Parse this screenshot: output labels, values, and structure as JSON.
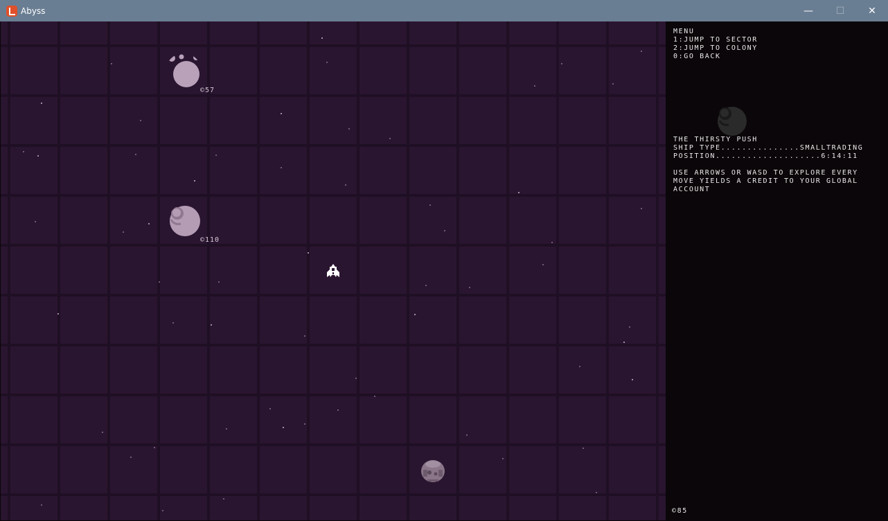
{
  "window": {
    "title": "Abyss",
    "controls": {
      "minimize": "—",
      "maximize": "☐",
      "close": "✕"
    }
  },
  "map": {
    "planets": [
      {
        "name": "planet-with-moons",
        "credit_label": "©57",
        "color": "#b8a1b9"
      },
      {
        "name": "cratered-planet",
        "credit_label": "©110",
        "color": "#b49cb5"
      }
    ],
    "player_ship": {
      "icon": "spaceship-icon",
      "color": "#ffffff"
    },
    "colony": {
      "icon": "colony-pod-icon",
      "color": "#8a7589"
    }
  },
  "panel": {
    "menu": {
      "title": "MENU",
      "items": [
        "1:JUMP TO SECTOR",
        "2:JUMP TO COLONY",
        "0:GO BACK"
      ]
    },
    "ship": {
      "name": "THE THIRSTY PUSH",
      "type_line": "SHIP TYPE...............SMALLTRADING",
      "position_line": "POSITION....................6:14:11"
    },
    "help": [
      "USE ARROWS OR WASD TO EXPLORE EVERY",
      "MOVE YIELDS A CREDIT TO YOUR GLOBAL",
      "ACCOUNT"
    ],
    "credits": "©85"
  },
  "colors": {
    "titlebar": "#6a7e93",
    "space": "#2a1530",
    "grid": "#1f0f24",
    "panel_bg": "#0b0609",
    "text": "#eaeaea"
  }
}
